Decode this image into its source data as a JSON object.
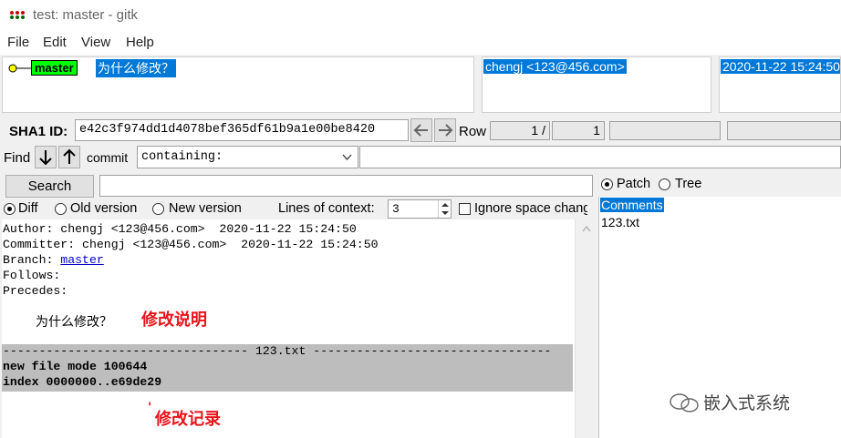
{
  "window": {
    "title": "test: master - gitk"
  },
  "menu": [
    "File",
    "Edit",
    "View",
    "Help"
  ],
  "commit_list": {
    "branch": "master",
    "message": "为什么修改？",
    "author": "chengj <123@456.com>",
    "date": "2020-11-22 15:24:50"
  },
  "sha": {
    "label": "SHA1 ID:",
    "value": "e42c3f974dd1d4078bef365df61b9a1e00be8420"
  },
  "row": {
    "label": "Row",
    "current": "1 /",
    "total": "1"
  },
  "find": {
    "label": "Find",
    "commit_label": "commit",
    "mode": "containing:"
  },
  "search": {
    "button": "Search"
  },
  "diff_opts": {
    "diff": "Diff",
    "old": "Old version",
    "new": "New version",
    "context_label": "Lines of context:",
    "context_value": "3",
    "ignore": "Ignore space chang"
  },
  "details": {
    "author": "Author: chengj <123@456.com>  2020-11-22 15:24:50",
    "committer": "Committer: chengj <123@456.com>  2020-11-22 15:24:50",
    "branch_label": "Branch: ",
    "branch_link": "master",
    "follows": "Follows:",
    "precedes": "Precedes:",
    "message": "为什么修改？",
    "file_header": "---------------------------------- 123.txt ---------------------------------",
    "mode": "new file mode 100644",
    "index": "index 0000000..e69de29"
  },
  "annotations": {
    "note1": "修改说明",
    "note2": "修改记录",
    "note2_mark": "'"
  },
  "right_pane": {
    "patch": "Patch",
    "tree": "Tree",
    "items": [
      "Comments",
      "123.txt"
    ]
  },
  "watermark": "嵌入式系统",
  "colors": {
    "selection": "#0078d7",
    "branch_tag": "#00ff00",
    "annotation": "#e8141b"
  }
}
